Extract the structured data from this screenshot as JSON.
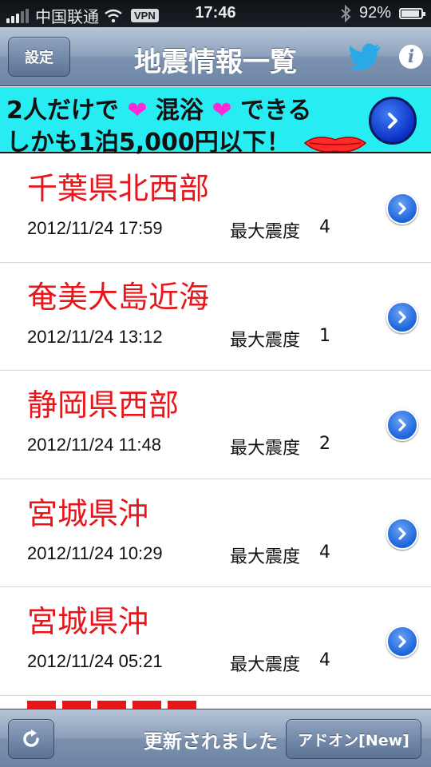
{
  "status_bar": {
    "carrier": "中国联通",
    "vpn": "VPN",
    "time": "17:46",
    "battery": "92%",
    "battery_level": 0.92
  },
  "nav": {
    "settings_label": "設定",
    "title": "地震情報一覧",
    "twitter_icon": "twitter-bird-icon",
    "info_icon": "i"
  },
  "ad": {
    "line1_a": "2人だけで",
    "line1_b": "混浴",
    "line1_c": "できる",
    "heart": "❤",
    "line2": "しかも1泊5,000円以下！"
  },
  "quakes": [
    {
      "region": "千葉県北西部",
      "datetime": "2012/11/24 17:59",
      "intensity_label": "最大震度",
      "intensity": "4"
    },
    {
      "region": "奄美大島近海",
      "datetime": "2012/11/24 13:12",
      "intensity_label": "最大震度",
      "intensity": "1"
    },
    {
      "region": "静岡県西部",
      "datetime": "2012/11/24 11:48",
      "intensity_label": "最大震度",
      "intensity": "2"
    },
    {
      "region": "宮城県沖",
      "datetime": "2012/11/24 10:29",
      "intensity_label": "最大震度",
      "intensity": "4"
    },
    {
      "region": "宮城県沖",
      "datetime": "2012/11/24 05:21",
      "intensity_label": "最大震度",
      "intensity": "4"
    }
  ],
  "toolbar": {
    "status_message": "更新されました",
    "addon_label": "アドオン[New]"
  },
  "colors": {
    "region_text": "#e8161b",
    "ad_background": "#27ecf2",
    "heart": "#ff2ad6"
  }
}
